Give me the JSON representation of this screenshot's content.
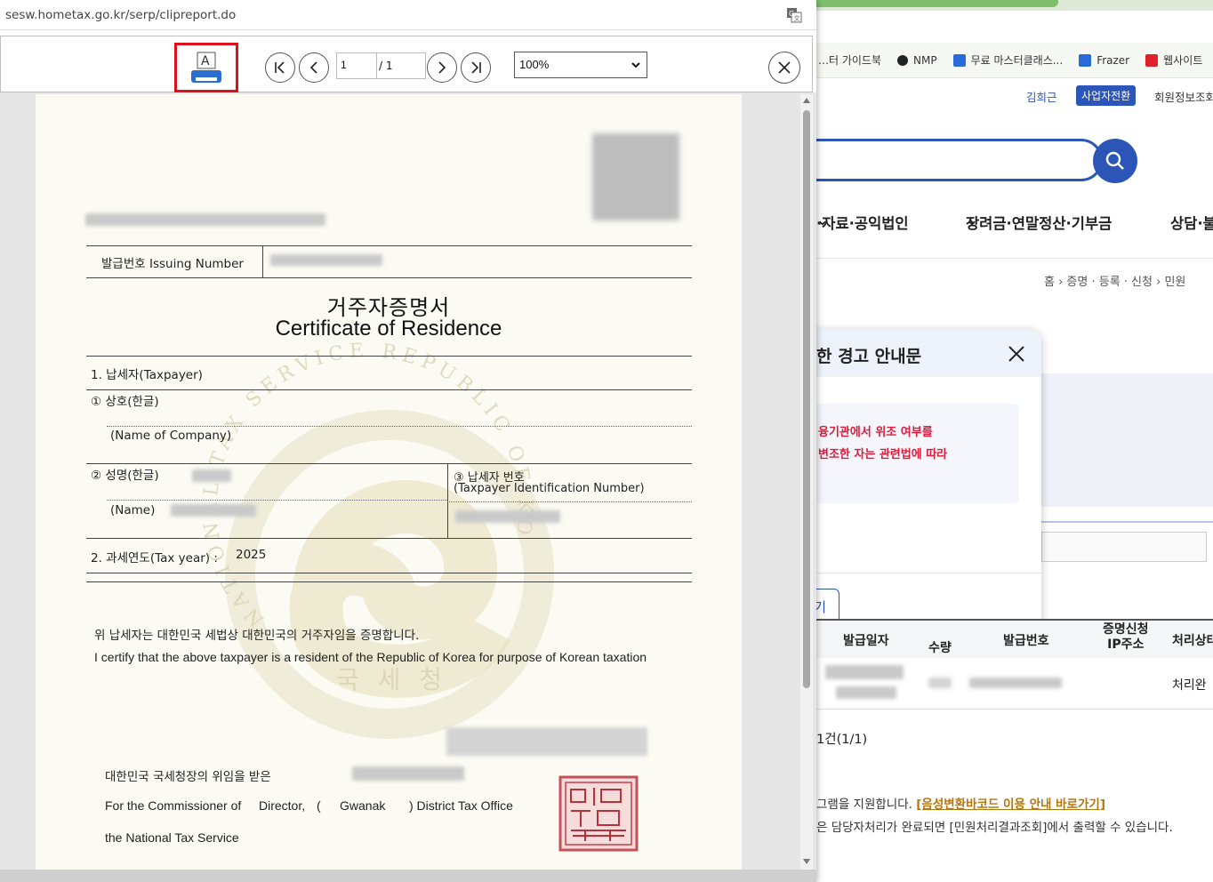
{
  "popup": {
    "url": "sesw.hometax.go.kr/serp/clipreport.do",
    "toolbar": {
      "print_icon_letter": "A",
      "page_current": "1",
      "page_total": "/ 1",
      "zoom": "100%"
    }
  },
  "certificate": {
    "issuing_number_label": "발급번호 Issuing Number",
    "title_ko": "거주자증명서",
    "title_en": "Certificate of Residence",
    "section1": "1. 납세자(Taxpayer)",
    "company_ko": "① 상호(한글)",
    "company_en": "(Name of Company)",
    "name_ko": "② 성명(한글)",
    "name_en": "(Name)",
    "tin_ko": "③ 납세자 번호",
    "tin_en": "(Taxpayer Identification Number)",
    "tax_year_label": "2. 과세연도(Tax year) :",
    "tax_year_value": "2025",
    "certify_ko": "위 납세자는 대한민국 세법상 대한민국의 거주자임을 증명합니다.",
    "certify_en": "I certify that the above taxpayer is a resident of the Republic of Korea for purpose of Korean taxation",
    "delegation_ko": "대한민국 국세청장의 위임을 받은",
    "commissioner_en": "For the Commissioner of",
    "director": "Director,",
    "paren_open": "(",
    "office_name": "Gwanak",
    "office_suffix": ") District Tax Office",
    "nts_en": "the National Tax Service",
    "watermark_text": "NATIONAL TAX SERVICE REPUBLIC OF KOREA",
    "watermark_ko": "국 세 청"
  },
  "background_page": {
    "bookmarks": [
      {
        "label": "…터 가이드북",
        "icon_color": "#ffffff"
      },
      {
        "label": "NMP",
        "icon_color": "#222222"
      },
      {
        "label": "무료 마스터클래스...",
        "icon_color": "#2a6ad8"
      },
      {
        "label": "Frazer",
        "icon_color": "#2a6ad8"
      },
      {
        "label": "웹사이트",
        "icon_color": "#e0202a"
      }
    ],
    "user_name": "김희근",
    "switch_button": "사업자전환",
    "member_info": "회원정보조회",
    "nav": [
      "·자료·공익법인",
      "장려금·연말정산·기부금",
      "상담·불"
    ],
    "breadcrumb": "홈 › 증명 · 등록 · 신청 › 민원",
    "modal": {
      "title": "한 경고 안내문",
      "line1": "융기관에서 위조 여부를",
      "line2": "변조한 자는 관련법에 따라",
      "button": "기"
    },
    "table_headers": [
      "발급일자",
      "수량",
      "발급번호",
      "증명신청\nIP주소",
      "처리상태"
    ],
    "row_status": "처리완",
    "count": "1건(1/1)",
    "note1_prefix": "그램을 지원합니다.",
    "note1_link": "[음성변환바코드 이용 안내 바로가기]",
    "note2": "은 담당자처리가 완료되면 [민원처리결과조회]에서 출력할 수 있습니다.",
    "colors": {
      "primary": "#2b56b8",
      "alert": "#e01a3a",
      "link": "#b8760a"
    }
  }
}
